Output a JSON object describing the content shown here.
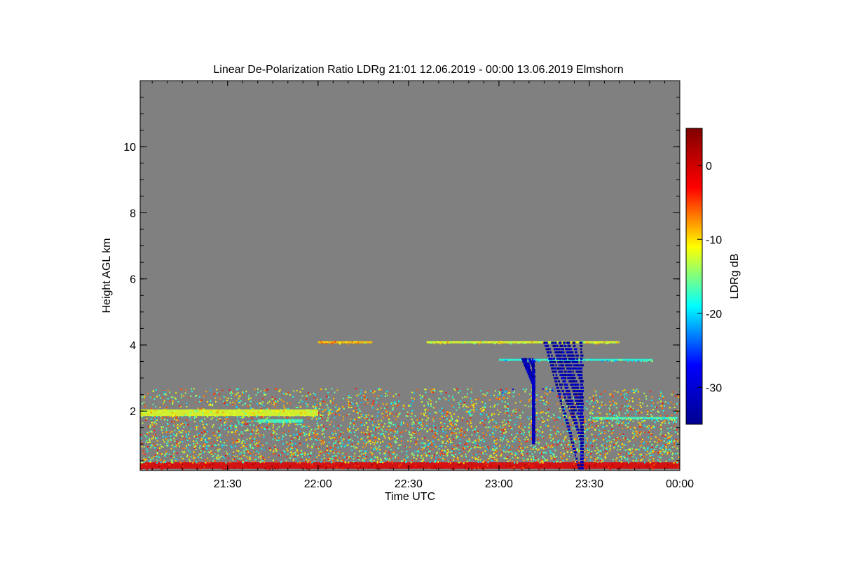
{
  "chart_data": {
    "type": "heatmap",
    "title": "Linear De-Polarization Ratio LDRg   21:01 12.06.2019 - 00:00 13.06.2019 Elmshorn",
    "xlabel": "Time UTC",
    "ylabel": "Height AGL km",
    "xlim": [
      "21:01",
      "00:00"
    ],
    "xticks": [
      "21:30",
      "22:00",
      "22:30",
      "23:00",
      "23:30",
      "00:00"
    ],
    "ylim": [
      0.2,
      12
    ],
    "yticks": [
      2,
      4,
      6,
      8,
      10
    ],
    "colorbar": {
      "label": "LDRg dB",
      "range": [
        -35,
        5
      ],
      "ticks": [
        0,
        -10,
        -20,
        -30
      ],
      "colormap": [
        "#00008f",
        "#0000ff",
        "#00ffff",
        "#ffff00",
        "#ff0000",
        "#800000"
      ]
    },
    "background_color": "#808080",
    "features": [
      {
        "type": "layer",
        "t0": "21:01",
        "t1": "00:00",
        "h0": 0.25,
        "h1": 0.45,
        "ldr": -1
      },
      {
        "type": "patch",
        "t0": "21:01",
        "t1": "00:00",
        "h0": 0.45,
        "h1": 2.7,
        "ldr": -12
      },
      {
        "type": "layer",
        "t0": "21:01",
        "t1": "22:00",
        "h0": 1.85,
        "h1": 2.05,
        "ldr": -12
      },
      {
        "type": "layer",
        "t0": "21:40",
        "t1": "21:55",
        "h0": 1.65,
        "h1": 1.75,
        "ldr": -17
      },
      {
        "type": "layer",
        "t0": "22:00",
        "t1": "22:18",
        "h0": 4.05,
        "h1": 4.12,
        "ldr": -9
      },
      {
        "type": "layer",
        "t0": "22:36",
        "t1": "23:40",
        "h0": 4.05,
        "h1": 4.12,
        "ldr": -12
      },
      {
        "type": "layer",
        "t0": "23:00",
        "t1": "23:51",
        "h0": 3.52,
        "h1": 3.58,
        "ldr": -18
      },
      {
        "type": "layer",
        "t0": "23:31",
        "t1": "23:59",
        "h0": 1.75,
        "h1": 1.82,
        "ldr": -17
      },
      {
        "type": "fallstreak",
        "t0": "23:07",
        "t1": "23:27",
        "h0": 0.2,
        "h1": 4.1,
        "ldr": -33
      },
      {
        "type": "fallstreak",
        "t0": "23:06",
        "t1": "23:11",
        "h0": 1.0,
        "h1": 3.6,
        "ldr": -32
      },
      {
        "type": "patch",
        "t0": "23:00",
        "t1": "23:05",
        "h0": 2.55,
        "h1": 2.7,
        "ldr": -20
      },
      {
        "type": "patch",
        "t0": "23:14",
        "t1": "23:18",
        "h0": 2.6,
        "h1": 2.75,
        "ldr": -23
      }
    ]
  }
}
